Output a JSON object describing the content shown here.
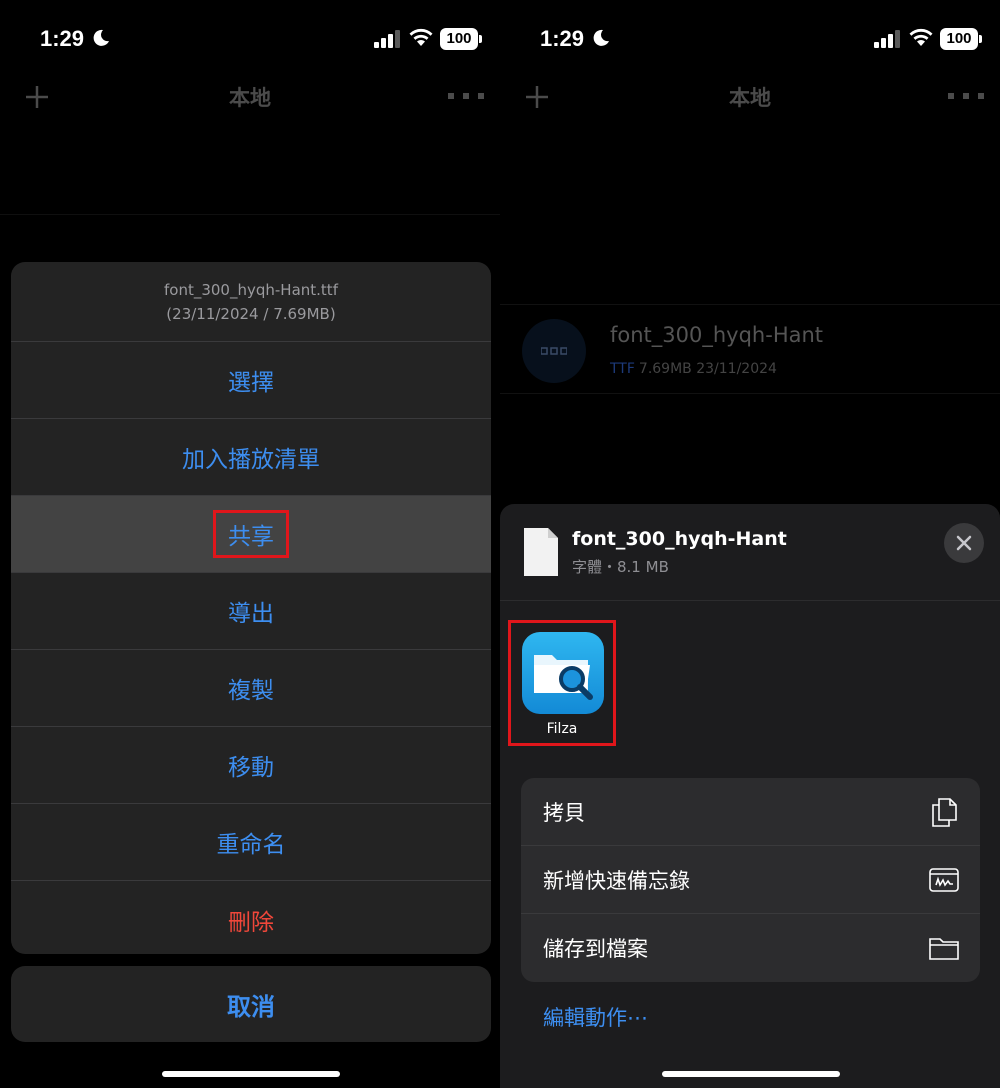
{
  "status_bar": {
    "time": "1:29",
    "battery": "100"
  },
  "left": {
    "nav": {
      "title": "本地"
    },
    "sheet": {
      "file_name": "font_300_hyqh-Hant.ttf",
      "file_meta": "(23/11/2024 / 7.69MB)",
      "items": [
        {
          "label": "選擇"
        },
        {
          "label": "加入播放清單"
        },
        {
          "label": "共享"
        },
        {
          "label": "導出"
        },
        {
          "label": "複製"
        },
        {
          "label": "移動"
        },
        {
          "label": "重命名"
        },
        {
          "label": "刪除"
        }
      ],
      "cancel_label": "取消"
    }
  },
  "right": {
    "nav": {
      "title": "本地"
    },
    "file_row": {
      "name": "font_300_hyqh-Hant",
      "ext": "TTF",
      "meta": "7.69MB 23/11/2024"
    },
    "share_sheet": {
      "file_name": "font_300_hyqh-Hant",
      "file_meta": "字體・8.1 MB",
      "app": {
        "name": "Filza"
      },
      "actions": [
        {
          "label": "拷貝",
          "icon": "copy-icon"
        },
        {
          "label": "新增快速備忘錄",
          "icon": "quick-note-icon"
        },
        {
          "label": "儲存到檔案",
          "icon": "folder-icon"
        }
      ],
      "edit_actions_label": "編輯動作⋯"
    }
  },
  "colors": {
    "accent": "#3d8ef0",
    "destructive": "#f0473a",
    "highlight": "#e0161b"
  }
}
